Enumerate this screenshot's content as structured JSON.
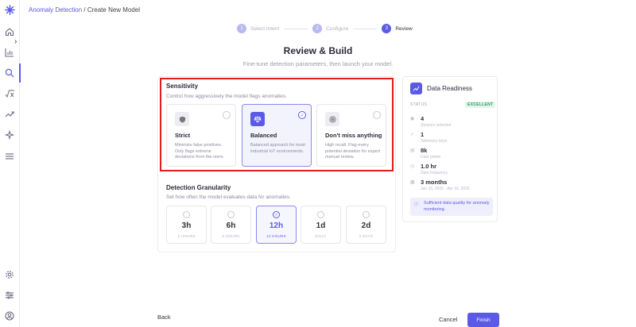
{
  "breadcrumb": {
    "link": "Anomaly Detection",
    "separator": " / ",
    "current": "Create New Model"
  },
  "stepper": {
    "steps": [
      {
        "num": "1",
        "label": "Select Intent"
      },
      {
        "num": "2",
        "label": "Configure"
      },
      {
        "num": "3",
        "label": "Review"
      }
    ]
  },
  "header": {
    "title": "Review & Build",
    "subtitle": "Fine-tune detection parameters, then launch your model."
  },
  "sensitivity": {
    "title": "Sensitivity",
    "description": "Control how aggressively the model flags anomalies.",
    "options": [
      {
        "title": "Strict",
        "description": "Minimize false positives. Only flags extreme deviations from the norm.",
        "icon": "shield-icon",
        "selected": false
      },
      {
        "title": "Balanced",
        "description": "Balanced approach for most industrial IoT environments.",
        "icon": "scale-icon",
        "selected": true
      },
      {
        "title": "Don't miss anything",
        "description": "High recall. Flag every potential deviation for expert manual review.",
        "icon": "target-icon",
        "selected": false
      }
    ]
  },
  "granularity": {
    "title": "Detection Granularity",
    "description": "Set how often the model evaluates data for anomalies.",
    "options": [
      {
        "value": "3h",
        "label": "3 HOURS",
        "selected": false
      },
      {
        "value": "6h",
        "label": "6 HOURS",
        "selected": false
      },
      {
        "value": "12h",
        "label": "12 HOURS",
        "selected": true
      },
      {
        "value": "1d",
        "label": "DAILY",
        "selected": false
      },
      {
        "value": "2d",
        "label": "2 DAYS",
        "selected": false
      }
    ]
  },
  "readiness": {
    "title": "Data Readiness",
    "status_label": "STATUS",
    "status_value": "EXCELLENT",
    "metrics": [
      {
        "value": "4",
        "label": "Sensors selected"
      },
      {
        "value": "1",
        "label": "Telemetry keys"
      },
      {
        "value": "8k",
        "label": "Data points"
      },
      {
        "value": "1.0 hr",
        "label": "Data frequency"
      },
      {
        "value": "3 months",
        "label": "Jan 16, 2026 - Apr 16, 2026"
      }
    ],
    "note": "Sufficient data quality for anomaly monitoring."
  },
  "footer": {
    "back": "Back",
    "cancel": "Cancel",
    "finish": "Finish"
  },
  "colors": {
    "accent": "#5a5ae6",
    "highlight": "#e31b1b",
    "success": "#2a9d5a"
  }
}
